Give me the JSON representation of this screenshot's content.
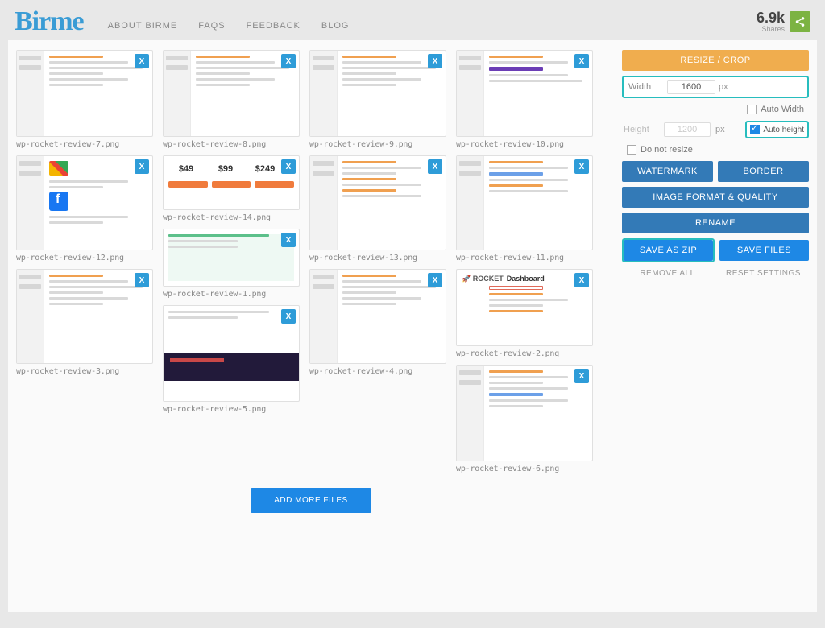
{
  "header": {
    "logo": "Birme",
    "nav": [
      "ABOUT BIRME",
      "FAQS",
      "FEEDBACK",
      "BLOG"
    ],
    "shares_count": "6.9k",
    "shares_label": "Shares"
  },
  "gallery": {
    "columns": [
      [
        {
          "filename": "wp-rocket-review-7.png",
          "h": "h1"
        },
        {
          "filename": "wp-rocket-review-12.png",
          "h": "h2"
        },
        {
          "filename": "wp-rocket-review-3.png",
          "h": "h2"
        }
      ],
      [
        {
          "filename": "wp-rocket-review-8.png",
          "h": "h1"
        },
        {
          "filename": "wp-rocket-review-14.png",
          "h": "h3"
        },
        {
          "filename": "wp-rocket-review-1.png",
          "h": "h7"
        },
        {
          "filename": "wp-rocket-review-5.png",
          "h": "h4"
        }
      ],
      [
        {
          "filename": "wp-rocket-review-9.png",
          "h": "h1"
        },
        {
          "filename": "wp-rocket-review-13.png",
          "h": "h2"
        },
        {
          "filename": "wp-rocket-review-4.png",
          "h": "h2"
        }
      ],
      [
        {
          "filename": "wp-rocket-review-10.png",
          "h": "h1"
        },
        {
          "filename": "wp-rocket-review-11.png",
          "h": "h2"
        },
        {
          "filename": "wp-rocket-review-2.png",
          "h": "h5"
        },
        {
          "filename": "wp-rocket-review-6.png",
          "h": "h4"
        }
      ]
    ],
    "close_x": "X",
    "add_more": "ADD MORE FILES",
    "prices": [
      "$49",
      "$99",
      "$249"
    ],
    "dashboard_label": "Dashboard",
    "rocket_label": "ROCKET"
  },
  "panel": {
    "resize_crop": "RESIZE / CROP",
    "width_label": "Width",
    "width_value": "1600",
    "height_label": "Height",
    "height_value": "1200",
    "px": "px",
    "auto_width": "Auto Width",
    "auto_height": "Auto height",
    "do_not_resize": "Do not resize",
    "watermark": "WATERMARK",
    "border": "BORDER",
    "image_format": "IMAGE FORMAT & QUALITY",
    "rename": "RENAME",
    "save_zip": "SAVE AS ZIP",
    "save_files": "SAVE FILES",
    "remove_all": "REMOVE ALL",
    "reset_settings": "RESET SETTINGS"
  }
}
